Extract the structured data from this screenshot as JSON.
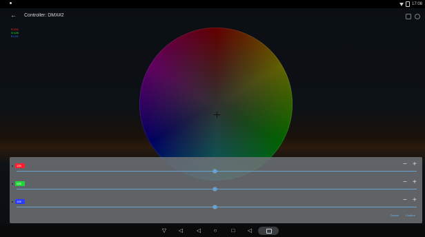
{
  "status": {
    "time": "17:08"
  },
  "app": {
    "title": "Controller: DMX#2",
    "back_glyph": "←"
  },
  "legend": {
    "r": "R:255",
    "g": "G:126",
    "b": "B:126"
  },
  "panel": {
    "rows": [
      {
        "name": "red",
        "value_label": "126",
        "chip_color": "#ff1f2f",
        "value": 126
      },
      {
        "name": "green",
        "value_label": "126",
        "chip_color": "#22d63a",
        "value": 126
      },
      {
        "name": "blue",
        "value_label": "126",
        "chip_color": "#2b3cff",
        "value": 126
      }
    ],
    "cancel_label": "Cancel",
    "confirm_label": "Confirm"
  },
  "nav": {
    "down": "▽",
    "vol_down": "◁",
    "back": "◁",
    "home": "○",
    "recent": "□",
    "vol_up": "◁"
  }
}
